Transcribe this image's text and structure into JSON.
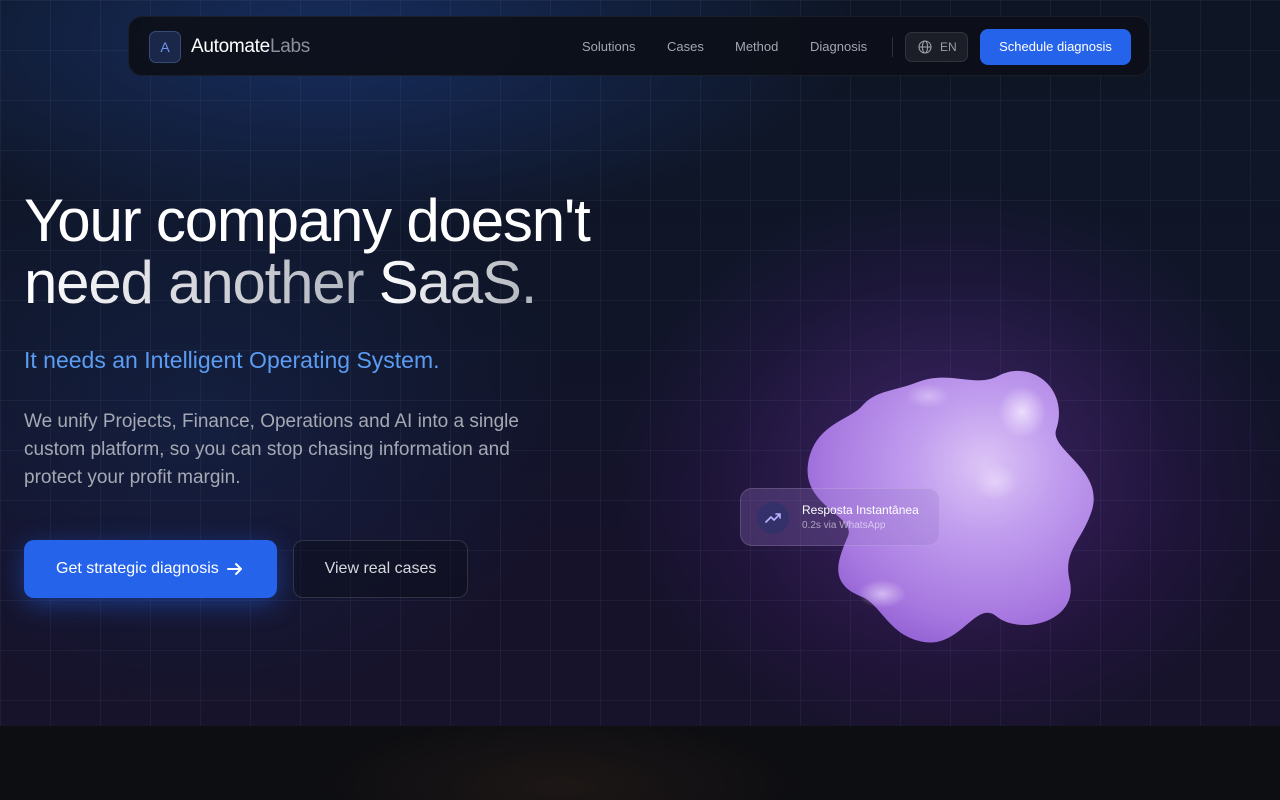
{
  "nav": {
    "logo_letter": "A",
    "brand_primary": "Automate",
    "brand_secondary": "Labs",
    "links": [
      "Solutions",
      "Cases",
      "Method",
      "Diagnosis"
    ],
    "language": "EN",
    "cta_label": "Schedule diagnosis"
  },
  "hero": {
    "headline_line1": "Your company doesn't",
    "headline_line2_a": "need another ",
    "headline_line2_b": "SaaS.",
    "tagline": "It needs an Intelligent Operating System.",
    "description": "We unify Projects, Finance, Operations and AI into a single custom platform, so you can stop chasing information and protect your profit margin.",
    "primary_cta": "Get strategic diagnosis",
    "secondary_cta": "View real cases"
  },
  "status_card": {
    "title": "Resposta Instantânea",
    "subtitle": "0.2s via WhatsApp",
    "icon": "trending-up-icon"
  },
  "colors": {
    "accent": "#2563eb",
    "tagline": "#5b9cf3",
    "blob": "#b48be6"
  }
}
